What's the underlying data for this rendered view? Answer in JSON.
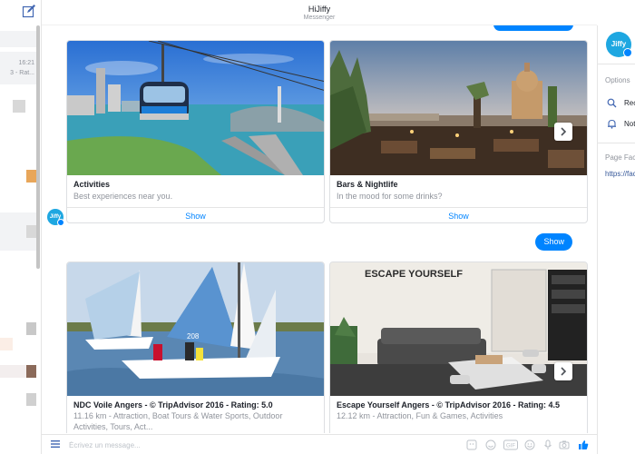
{
  "header": {
    "title": "HiJiffy",
    "subtitle": "Messenger"
  },
  "left_rail": {
    "conversation": {
      "time": "16:21",
      "preview": "3 - Rat..."
    }
  },
  "bot": {
    "avatar_text": "Jiffy"
  },
  "cards_row1": [
    {
      "title": "Activities",
      "subtitle": "Best experiences near you.",
      "action": "Show"
    },
    {
      "title": "Bars & Nightlife",
      "subtitle": "In the mood for some drinks?",
      "action": "Show"
    }
  ],
  "show_bubble": "Show",
  "cards_row2": [
    {
      "title": "NDC Voile Angers - © TripAdvisor 2016 - Rating: 5.0",
      "subtitle": "11.16 km - Attraction, Boat Tours & Water Sports, Outdoor Activities, Tours, Act..."
    },
    {
      "title": "Escape Yourself Angers - © TripAdvisor 2016 - Rating: 4.5",
      "subtitle": "12.12 km - Attraction, Fun & Games, Activities",
      "sign_text": "ESCAPE YOURSELF"
    }
  ],
  "composer": {
    "placeholder": "Écrivez un message..."
  },
  "right_panel": {
    "avatar_text": "Jiffy",
    "options_label": "Options",
    "options": [
      {
        "icon": "search-icon",
        "label": "Rec"
      },
      {
        "icon": "bell-icon",
        "label": "Not"
      }
    ],
    "page_label": "Page Face",
    "page_link": "https://face"
  },
  "colors": {
    "accent": "#0084ff",
    "bot_blue": "#1ea7e1",
    "link": "#365899"
  }
}
